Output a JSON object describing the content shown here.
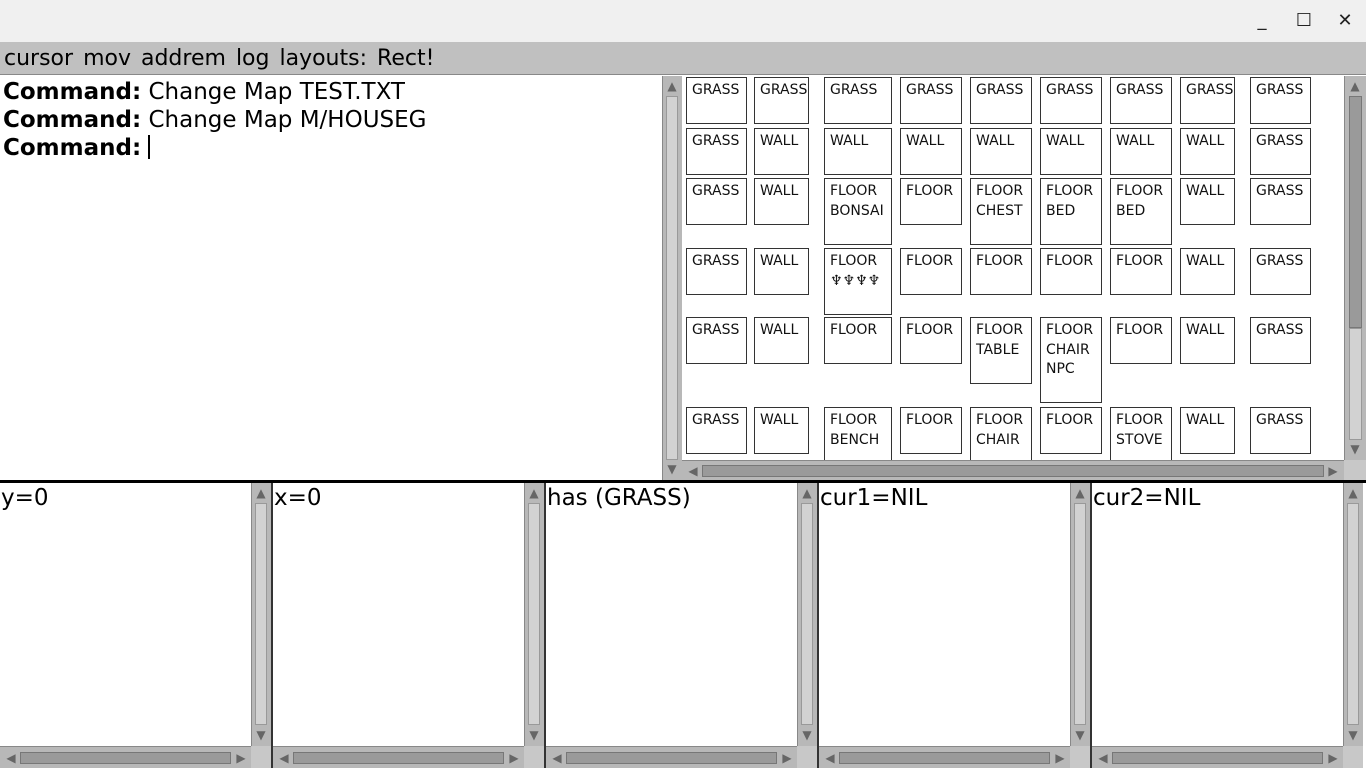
{
  "window": {
    "minimize_glyph": "_",
    "maximize_glyph": "☐",
    "close_glyph": "✕"
  },
  "menu": [
    "cursor",
    "mov",
    "addrem",
    "log",
    "layouts:",
    "Rect!"
  ],
  "console": {
    "prompt_label": "Command:",
    "lines": [
      {
        "label": "Command:",
        "text": " Change Map TEST.TXT"
      },
      {
        "label": "Command:",
        "text": " Change Map M/HOUSEG"
      },
      {
        "label": "Command:",
        "text": " "
      }
    ]
  },
  "map": {
    "rows": [
      [
        "GRASS",
        "GRASS",
        "GRASS",
        "GRASS",
        "GRASS",
        "GRASS",
        "GRASS",
        "GRASS",
        "GRASS"
      ],
      [
        "GRASS",
        "WALL",
        "WALL",
        "WALL",
        "WALL",
        "WALL",
        "WALL",
        "WALL",
        "GRASS"
      ],
      [
        "GRASS",
        "WALL",
        "FLOOR\nBONSAI",
        "FLOOR",
        "FLOOR\nCHEST",
        "FLOOR\nBED",
        "FLOOR\nBED",
        "WALL",
        "GRASS"
      ],
      [
        "GRASS",
        "WALL",
        "FLOOR\n♆♆♆♆",
        "FLOOR",
        "FLOOR",
        "FLOOR",
        "FLOOR",
        "WALL",
        "GRASS"
      ],
      [
        "GRASS",
        "WALL",
        "FLOOR",
        "FLOOR",
        "FLOOR\nTABLE",
        "FLOOR\nCHAIR\nNPC",
        "FLOOR",
        "WALL",
        "GRASS"
      ],
      [
        "GRASS",
        "WALL",
        "FLOOR\nBENCH",
        "FLOOR",
        "FLOOR\nCHAIR",
        "FLOOR",
        "FLOOR\nSTOVE",
        "WALL",
        "GRASS"
      ]
    ]
  },
  "status_panes": [
    {
      "id": "y",
      "text": "y=0"
    },
    {
      "id": "x",
      "text": "x=0"
    },
    {
      "id": "has",
      "text": "has (GRASS)"
    },
    {
      "id": "cur1",
      "text": "cur1=NIL"
    },
    {
      "id": "cur2",
      "text": "cur2=NIL"
    }
  ],
  "icons": {
    "up": "▲",
    "down": "▼",
    "left": "◀",
    "right": "▶"
  }
}
